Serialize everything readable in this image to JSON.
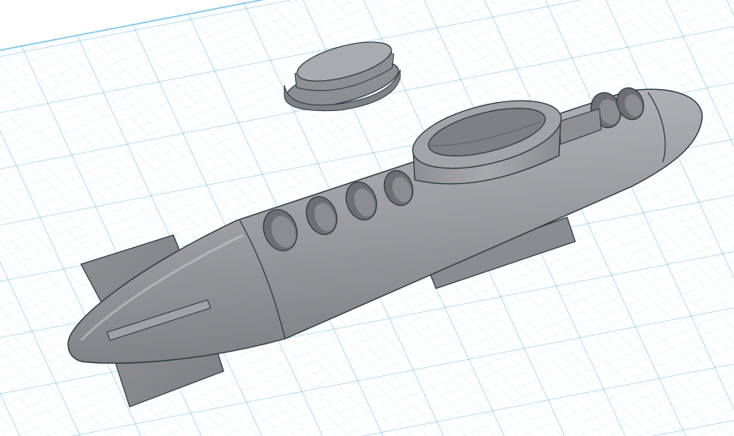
{
  "workplane": {
    "grid_color": "#9fd3ee",
    "grid_major_color": "#6dbde4",
    "background": "#ffffff"
  },
  "model": {
    "part_color": "#9a9c9f",
    "part_shadow": "#6f7174",
    "part_highlight": "#b9bbbe",
    "edge_color": "#2b3a44",
    "objects": [
      {
        "name": "submarine-hull"
      },
      {
        "name": "conning-tower"
      },
      {
        "name": "tower-cap"
      },
      {
        "name": "tail-fin-left"
      },
      {
        "name": "keel-fin"
      },
      {
        "name": "porthole-window"
      }
    ]
  }
}
